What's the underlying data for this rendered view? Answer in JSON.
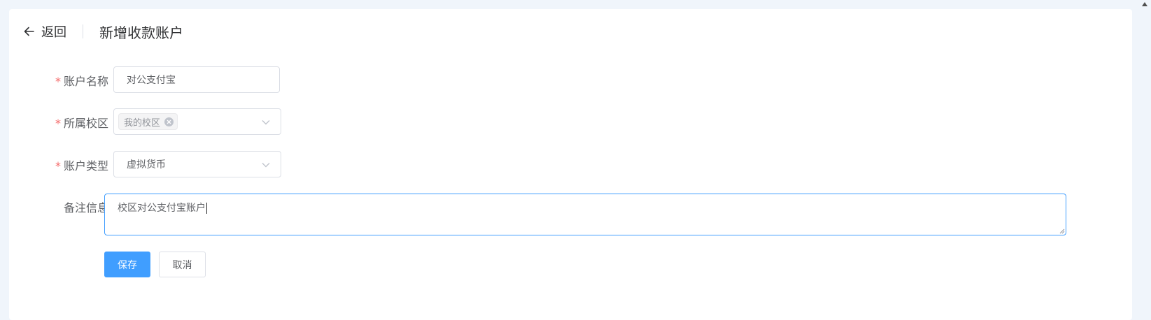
{
  "header": {
    "back_label": "返回",
    "title": "新增收款账户"
  },
  "form": {
    "account_name": {
      "label": "账户名称",
      "required_mark": "*",
      "value": "对公支付宝"
    },
    "campus": {
      "label": "所属校区",
      "required_mark": "*",
      "selected_tags": [
        "我的校区"
      ]
    },
    "account_type": {
      "label": "账户类型",
      "required_mark": "*",
      "value": "虚拟货币"
    },
    "remark": {
      "label": "备注信息",
      "value": "校区对公支付宝账户"
    }
  },
  "actions": {
    "save_label": "保存",
    "cancel_label": "取消"
  },
  "colors": {
    "primary": "#409eff",
    "required": "#f56c6c",
    "background": "#f0f5fb"
  }
}
